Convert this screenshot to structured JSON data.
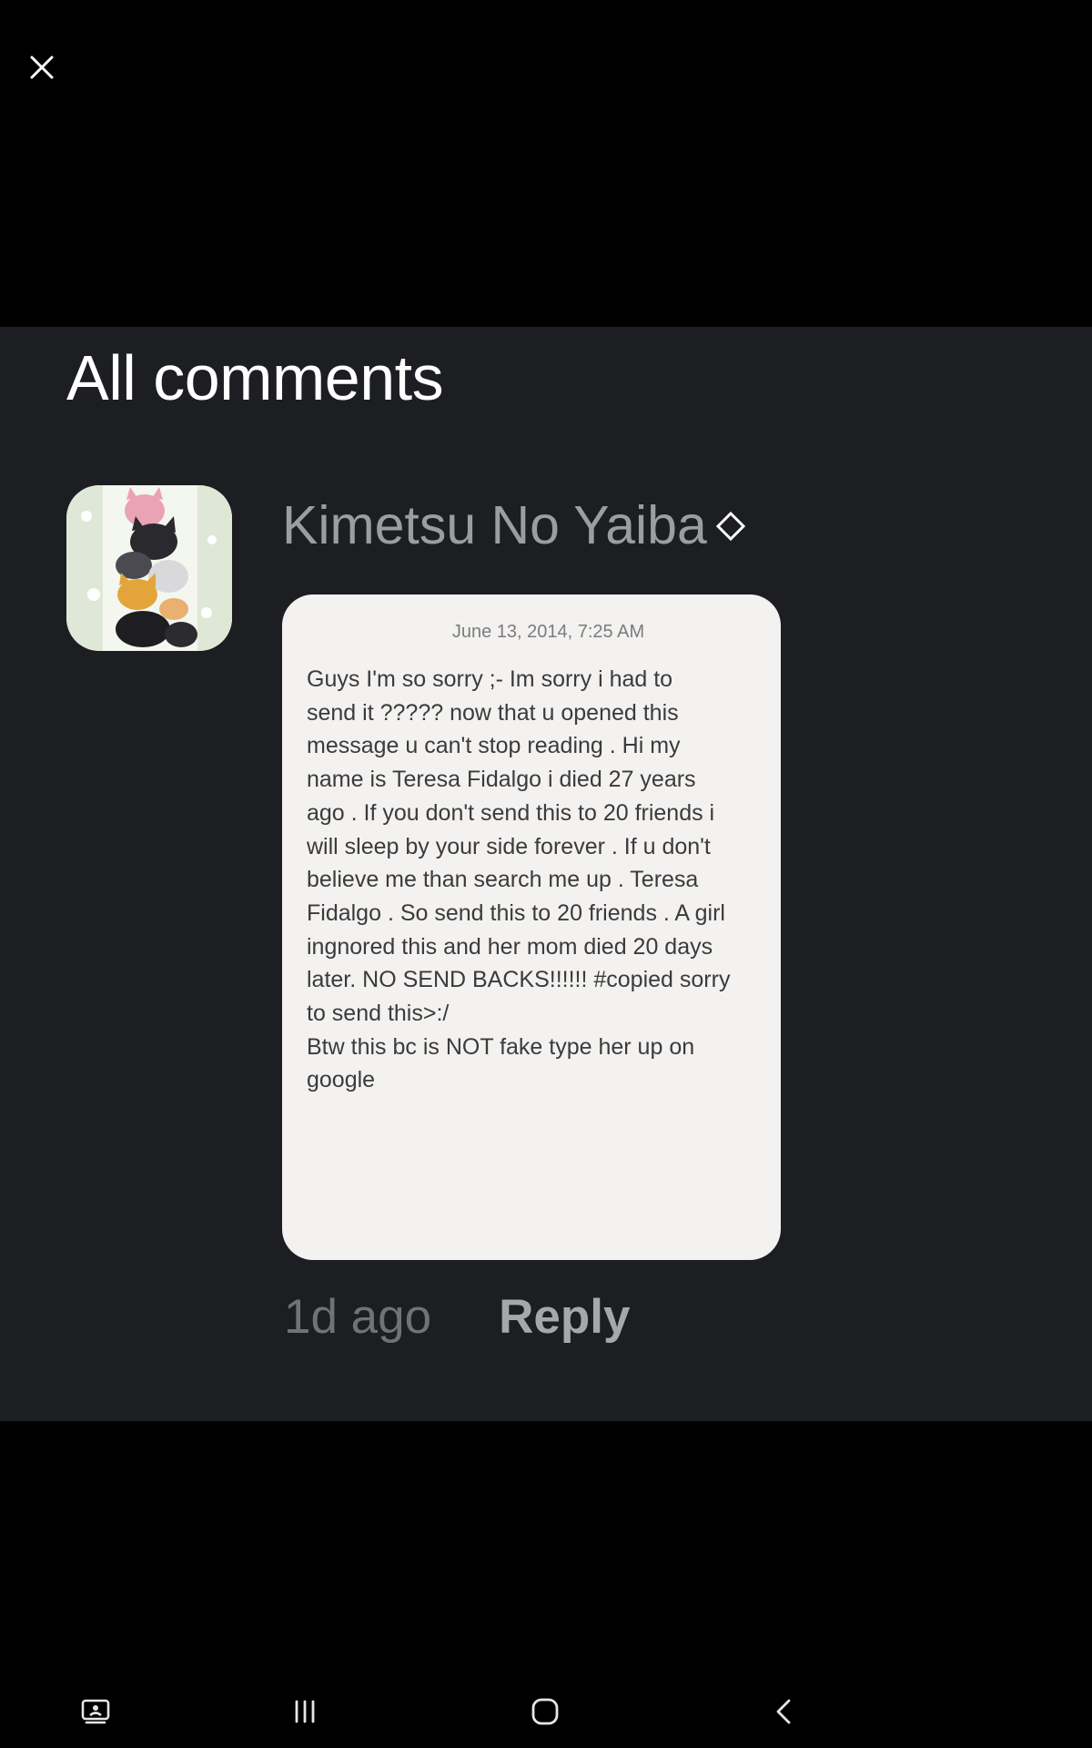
{
  "viewer": {
    "close_icon": "close-icon"
  },
  "panel": {
    "title": "All comments",
    "background": "#1c1e22"
  },
  "comment": {
    "avatar_icon": "avatar-anime-cats",
    "username": "Kimetsu No Yaiba",
    "username_suffix_icon": "diamond-outline-icon",
    "attachment": {
      "date": "June 13, 2014, 7:25 AM",
      "body": "Guys I'm so sorry ;- Im sorry i had to\nsend it ????? now that u opened this\nmessage u can't stop reading . Hi my\nname is Teresa Fidalgo i died 27 years\nago . If you don't send this to 20 friends i\nwill sleep by your side forever . If u don't\nbelieve me than search me up . Teresa\nFidalgo . So send this to 20 friends . A girl\ningnored this and her mom died 20 days\nlater. NO SEND BACKS!!!!!! #copied sorry\nto send this>:/\nBtw this bc is NOT fake type her up on\ngoogle"
    },
    "time_ago": "1d ago",
    "reply_label": "Reply"
  },
  "navigation": {
    "items": [
      {
        "icon": "screen-share-icon"
      },
      {
        "icon": "recent-apps-icon"
      },
      {
        "icon": "home-icon"
      },
      {
        "icon": "back-icon"
      }
    ]
  },
  "colors": {
    "screen_bg": "#000000",
    "panel_bg": "#1c1e22",
    "title_text": "#ffffff",
    "username_text": "#9c9da0",
    "card_bg": "#f3f2f1"
  }
}
